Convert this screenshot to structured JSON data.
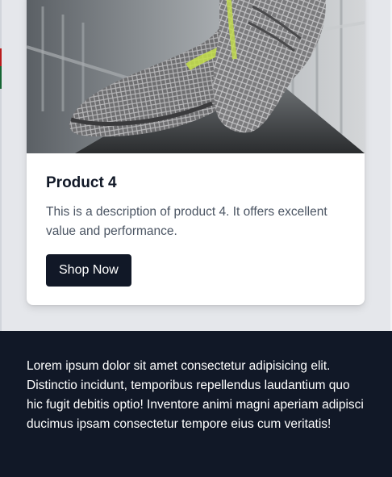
{
  "product": {
    "title": "Product 4",
    "description": "This is a description of product 4. It offers excellent value and performance.",
    "button_label": "Shop Now",
    "image_icon": "sneaker-photo"
  },
  "footer": {
    "text": "Lorem ipsum dolor sit amet consectetur adipisicing elit. Distinctio incidunt, temporibus repellendus laudantium quo hic fugit debitis optio! Inventore animi magni aperiam adipisci ducimus ipsam consectetur tempore eius cum veritatis!"
  },
  "colors": {
    "page_bg": "#e5e7eb",
    "card_bg": "#ffffff",
    "button_bg": "#111827",
    "footer_bg": "#111827",
    "title": "#111827",
    "description": "#4b5563"
  }
}
